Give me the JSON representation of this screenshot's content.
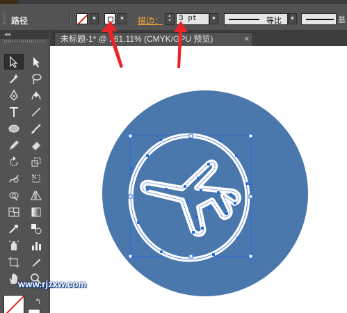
{
  "control_bar": {
    "panel_label": "路径",
    "fill_color_label": "fill-none",
    "stroke_color_label": "stroke-white",
    "stroke_label": "描边：",
    "stroke_weight": "3 pt",
    "profile_label": "等比",
    "brush_label_cut": "基"
  },
  "document": {
    "tab_title": "未标题-1* @ 261.11% (CMYK/GPU 预览)",
    "close_glyph": "×"
  },
  "toolbox": {
    "collapse_glyph": "◂◂"
  },
  "colors": {
    "background_circle": "#4a77ac",
    "artwork_stroke": "#ffffff",
    "selection": "#2f6bd8",
    "annotation_arrow": "#e8262a",
    "watermark": "#ffffff"
  },
  "watermark": {
    "text": "www.rjzxw.com"
  },
  "icons": [
    "selection-tool-icon",
    "direct-selection-tool-icon",
    "magic-wand-icon",
    "lasso-icon",
    "pen-icon",
    "curvature-icon",
    "type-icon",
    "line-icon",
    "ellipse-icon",
    "paintbrush-icon",
    "pencil-icon",
    "eraser-icon",
    "rotate-icon",
    "scale-icon",
    "warp-icon",
    "free-transform-icon",
    "shape-builder-icon",
    "perspective-icon",
    "mesh-icon",
    "gradient-icon",
    "eyedropper-icon",
    "blend-icon",
    "symbol-sprayer-icon",
    "column-graph-icon",
    "artboard-icon",
    "slice-icon",
    "hand-icon",
    "zoom-icon",
    "swap-colors-icon"
  ]
}
